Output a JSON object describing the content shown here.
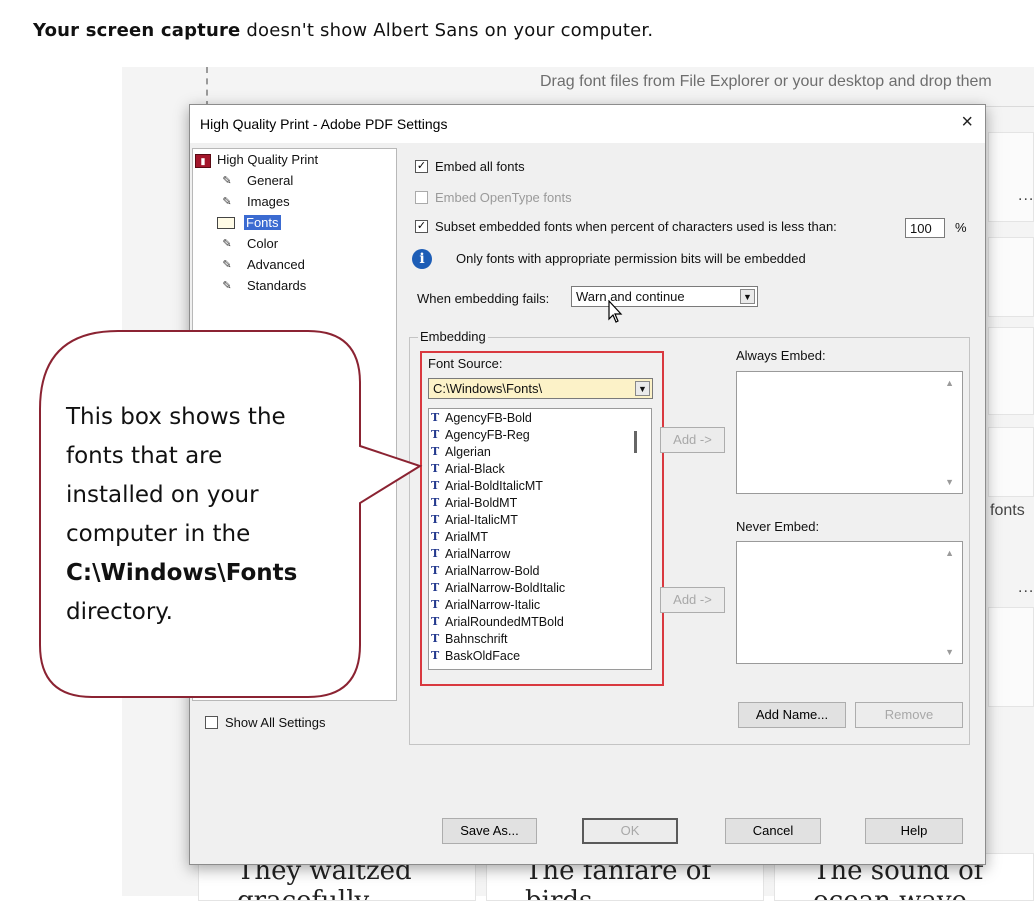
{
  "caption": {
    "bold": "Your screen capture",
    "rest": " doesn't show Albert Sans on your computer."
  },
  "background": {
    "drop_hint": "Drag font files from File Explorer or your desktop and drop them",
    "fonts_text": "fonts",
    "dots": "...",
    "tiles": [
      "They waltzed gracefully",
      "The fanfare of birds",
      "The sound of ocean wave"
    ]
  },
  "dialog": {
    "title": "High Quality Print - Adobe PDF Settings",
    "close": "×",
    "tree": {
      "root": "High Quality Print",
      "items": [
        "General",
        "Images",
        "Fonts",
        "Color",
        "Advanced",
        "Standards"
      ],
      "selected": "Fonts"
    },
    "embed_all_fonts": {
      "label": "Embed all fonts",
      "checked": true
    },
    "embed_opentype": {
      "label": "Embed OpenType fonts",
      "checked": false,
      "disabled": true
    },
    "subset": {
      "label": "Subset embedded fonts when percent of characters used is less than:",
      "checked": true,
      "value": "100",
      "unit": "%"
    },
    "info": "Only fonts with appropriate permission bits will be embedded",
    "when_fails": {
      "label": "When embedding fails:",
      "value": "Warn and continue"
    },
    "embedding_group": "Embedding",
    "font_source": {
      "label": "Font Source:",
      "value": "C:\\Windows\\Fonts\\",
      "fonts": [
        "AgencyFB-Bold",
        "AgencyFB-Reg",
        "Algerian",
        "Arial-Black",
        "Arial-BoldItalicMT",
        "Arial-BoldMT",
        "Arial-ItalicMT",
        "ArialMT",
        "ArialNarrow",
        "ArialNarrow-Bold",
        "ArialNarrow-BoldItalic",
        "ArialNarrow-Italic",
        "ArialRoundedMTBold",
        "Bahnschrift",
        "BaskOldFace"
      ]
    },
    "always_embed": "Always Embed:",
    "never_embed": "Never Embed:",
    "add_button": "Add ->",
    "add_name": "Add Name...",
    "remove": "Remove",
    "show_all": {
      "label": "Show All Settings",
      "checked": false
    },
    "buttons": {
      "save_as": "Save As...",
      "ok": "OK",
      "cancel": "Cancel",
      "help": "Help"
    }
  },
  "callout": {
    "lines": [
      "This box shows the",
      "fonts that are",
      "installed on your",
      "computer in the"
    ],
    "bold_line": "C:\\Windows\\Fonts",
    "last_line": "directory."
  }
}
